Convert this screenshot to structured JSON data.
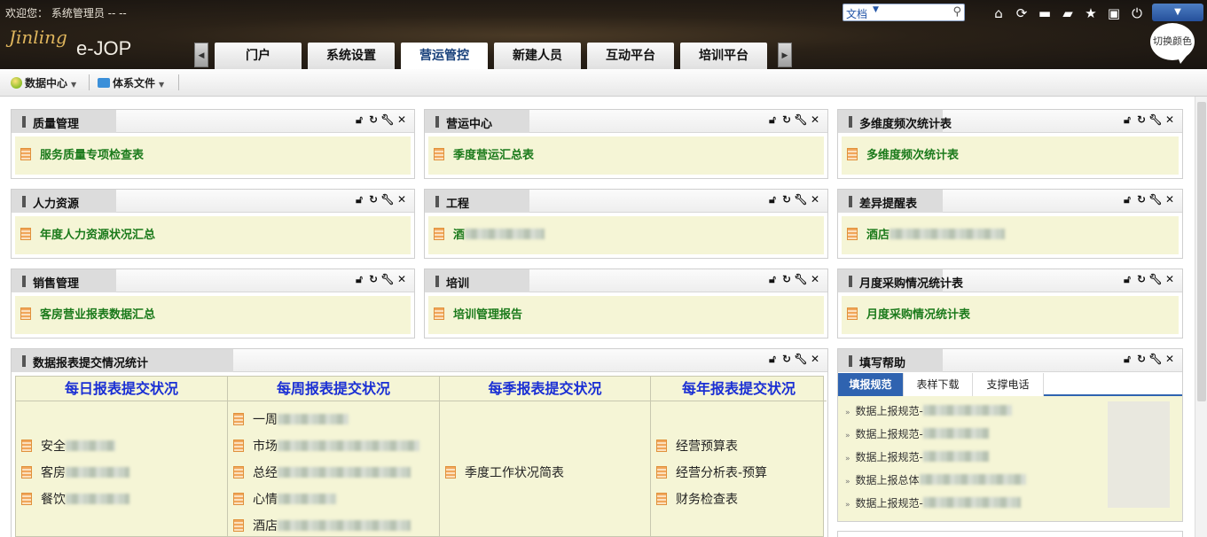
{
  "header": {
    "welcome": "欢迎您： 系统管理员 -- --",
    "search_scope": "文档",
    "brand": "e-JOP",
    "logo_text": "Jinling",
    "color_switch": "切换颜色",
    "tabs": [
      "门户",
      "系统设置",
      "营运管控",
      "新建人员",
      "互动平台",
      "培训平台"
    ],
    "active_tab": "营运管控",
    "icons": [
      "home-icon",
      "refresh-icon",
      "message-icon",
      "tag-icon",
      "star-icon",
      "minimize-icon",
      "power-icon",
      "menu-dropdown-icon"
    ]
  },
  "toolbar": {
    "data_center": "数据中心",
    "system_files": "体系文件"
  },
  "portlets": {
    "quality": {
      "title": "质量管理",
      "link": "服务质量专项检查表"
    },
    "ops_center": {
      "title": "营运中心",
      "link": "季度营运汇总表"
    },
    "multi_stats": {
      "title": "多维度频次统计表",
      "link": "多维度频次统计表"
    },
    "hr": {
      "title": "人力资源",
      "link": "年度人力资源状况汇总"
    },
    "engineering": {
      "title": "工程",
      "link": "酒"
    },
    "variance": {
      "title": "差异提醒表",
      "link": "酒店"
    },
    "sales": {
      "title": "销售管理",
      "link": "客房营业报表数据汇总"
    },
    "training": {
      "title": "培训",
      "link": "培训管理报告"
    },
    "purchasing": {
      "title": "月度采购情况统计表",
      "link": "月度采购情况统计表"
    },
    "submission": {
      "title": "数据报表提交情况统计",
      "columns": [
        {
          "header": "每日报表提交状况",
          "items": [
            "安全",
            "客房",
            "餐饮"
          ]
        },
        {
          "header": "每周报表提交状况",
          "items": [
            "一周",
            "市场",
            "总经",
            "心情",
            "酒店"
          ]
        },
        {
          "header": "每季报表提交状况",
          "items": [
            "季度工作状况简表"
          ]
        },
        {
          "header": "每年报表提交状况",
          "items": [
            "经营预算表",
            "经营分析表-预算",
            "财务检查表"
          ]
        }
      ]
    },
    "help": {
      "title": "填写帮助",
      "tabs": [
        "填报规范",
        "表样下载",
        "支撑电话"
      ],
      "active_tab": "填报规范",
      "items": [
        "数据上报规范-",
        "数据上报规范-",
        "数据上报规范-",
        "数据上报总体",
        "数据上报规范-"
      ]
    }
  }
}
